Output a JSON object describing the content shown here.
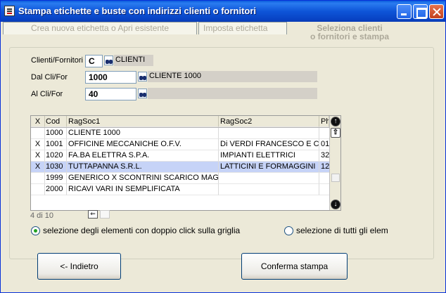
{
  "window": {
    "title": "Stampa etichette e buste con indirizzi clienti o fornitori"
  },
  "tabs": [
    {
      "label": "Crea nuova etichetta o Apri esistente"
    },
    {
      "label": "Imposta etichetta"
    },
    {
      "label_line1": "Seleziona clienti",
      "label_line2": "o fornitori e stampa"
    }
  ],
  "form": {
    "type_label": "Clienti/Fornitori",
    "type_value": "C",
    "type_desc": "CLIENTI",
    "from_label": "Dal Cli/For",
    "from_value": "1000",
    "from_desc": "CLIENTE 1000",
    "to_label": "Al Cli/For",
    "to_value": "40",
    "to_desc": ""
  },
  "grid": {
    "headers": {
      "x": "X",
      "cod": "Cod",
      "ragsoc1": "RagSoc1",
      "ragsoc2": "RagSoc2",
      "ph": "Ph"
    },
    "rows": [
      {
        "x": "",
        "cod": "1000",
        "ragsoc1": "CLIENTE 1000",
        "ragsoc2": "",
        "ph": ""
      },
      {
        "x": "X",
        "cod": "1001",
        "ragsoc1": "OFFICINE MECCANICHE O.F.V.",
        "ragsoc2": "Di VERDI FRANCESCO E C.",
        "ph": "01"
      },
      {
        "x": "X",
        "cod": "1020",
        "ragsoc1": "FA.BA ELETTRA S.P.A.",
        "ragsoc2": "IMPIANTI ELETTRICI",
        "ph": "32"
      },
      {
        "x": "X",
        "cod": "1030",
        "ragsoc1": "TUTTAPANNA S.R.L.",
        "ragsoc2": "LATTICINI E FORMAGGINI",
        "ph": "12"
      },
      {
        "x": "",
        "cod": "1999",
        "ragsoc1": "GENERICO X SCONTRINI SCARICO MAG.",
        "ragsoc2": "",
        "ph": ""
      },
      {
        "x": "",
        "cod": "2000",
        "ragsoc1": "RICAVI VARI IN SEMPLIFICATA",
        "ragsoc2": "",
        "ph": ""
      }
    ],
    "position_label": "4 di 10"
  },
  "options": {
    "radio1": "selezione degli elementi  con doppio click sulla griglia",
    "radio2": "selezione di tutti gli elem"
  },
  "buttons": {
    "back": "<- Indietro",
    "confirm": "Conferma stampa"
  }
}
